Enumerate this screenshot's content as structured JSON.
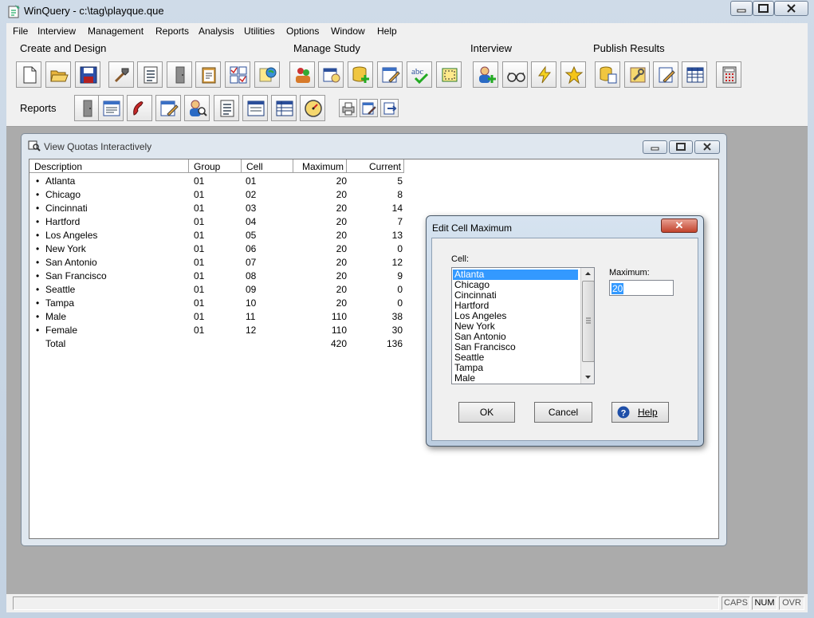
{
  "window": {
    "title": "WinQuery - c:\\tag\\playque.que",
    "min_glyph": "▭",
    "max_glyph": "□",
    "close_glyph": "✕"
  },
  "menu": [
    "File",
    "Interview",
    "Management",
    "Reports",
    "Analysis",
    "Utilities",
    "Options",
    "Window",
    "Help"
  ],
  "toolbar": {
    "groups": [
      "Create and Design",
      "Manage Study",
      "Interview",
      "Publish Results"
    ],
    "reports_label": "Reports"
  },
  "quota_window": {
    "title": "View Quotas Interactively",
    "columns": [
      "Description",
      "Group",
      "Cell",
      "Maximum",
      "Current"
    ],
    "rows": [
      {
        "description": "Atlanta",
        "group": "01",
        "cell": "01",
        "maximum": "20",
        "current": "5"
      },
      {
        "description": "Chicago",
        "group": "01",
        "cell": "02",
        "maximum": "20",
        "current": "8"
      },
      {
        "description": "Cincinnati",
        "group": "01",
        "cell": "03",
        "maximum": "20",
        "current": "14"
      },
      {
        "description": "Hartford",
        "group": "01",
        "cell": "04",
        "maximum": "20",
        "current": "7"
      },
      {
        "description": "Los Angeles",
        "group": "01",
        "cell": "05",
        "maximum": "20",
        "current": "13"
      },
      {
        "description": "New York",
        "group": "01",
        "cell": "06",
        "maximum": "20",
        "current": "0"
      },
      {
        "description": "San Antonio",
        "group": "01",
        "cell": "07",
        "maximum": "20",
        "current": "12"
      },
      {
        "description": "San Francisco",
        "group": "01",
        "cell": "08",
        "maximum": "20",
        "current": "9"
      },
      {
        "description": "Seattle",
        "group": "01",
        "cell": "09",
        "maximum": "20",
        "current": "0"
      },
      {
        "description": "Tampa",
        "group": "01",
        "cell": "10",
        "maximum": "20",
        "current": "0"
      },
      {
        "description": "Male",
        "group": "01",
        "cell": "11",
        "maximum": "110",
        "current": "38"
      },
      {
        "description": "Female",
        "group": "01",
        "cell": "12",
        "maximum": "110",
        "current": "30"
      }
    ],
    "total": {
      "label": "Total",
      "maximum": "420",
      "current": "136"
    }
  },
  "dialog": {
    "title": "Edit Cell Maximum",
    "cell_label": "Cell:",
    "cells": [
      "Atlanta",
      "Chicago",
      "Cincinnati",
      "Hartford",
      "Los Angeles",
      "New York",
      "San Antonio",
      "San Francisco",
      "Seattle",
      "Tampa",
      "Male"
    ],
    "selected_cell": "Atlanta",
    "maximum_label": "Maximum:",
    "maximum_value": "20",
    "ok": "OK",
    "cancel": "Cancel",
    "help": "Help",
    "close_glyph": "✕",
    "selection_color": "#3399ff"
  },
  "statusbar": {
    "caps": "CAPS",
    "num": "NUM",
    "ovr": "OVR"
  }
}
